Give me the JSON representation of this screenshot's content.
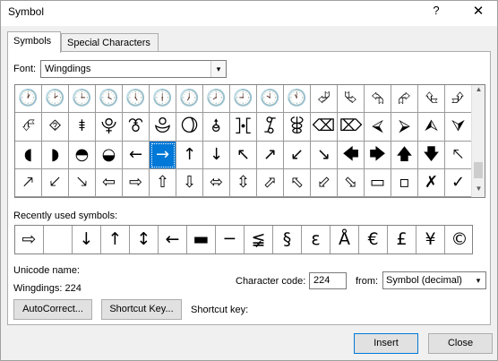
{
  "dialog": {
    "title": "Symbol",
    "help_label": "?",
    "close_glyph": "✕"
  },
  "tabs": [
    {
      "label": "Symbols",
      "active": true
    },
    {
      "label": "Special Characters",
      "active": false
    }
  ],
  "font": {
    "label": "Font:",
    "value": "Wingdings",
    "dropdown_glyph": "▾"
  },
  "symbol_grid": {
    "selected_index": 39,
    "rows": [
      [
        "🕐",
        "🕑",
        "🕒",
        "🕓",
        "🕔",
        "🕕",
        "🕖",
        "🕗",
        "🕘",
        "🕙",
        "🕚",
        "⮰",
        "⮱",
        "⮲",
        "⮳",
        "⮴",
        "⮵"
      ],
      [
        "⮶",
        "⯑",
        "⯒",
        "⯓",
        "⯔",
        "⯕",
        "⯖",
        "⯗",
        "⯘",
        "⯙",
        "⯚",
        "⌫",
        "⌦",
        "⮘",
        "⮚",
        "⮙",
        "⮛"
      ],
      [
        "◖",
        "◗",
        "◓",
        "◒",
        "←",
        "→",
        "↑",
        "↓",
        "↖",
        "↗",
        "↙",
        "↘",
        "🡄",
        "🡆",
        "🡅",
        "🡇",
        "🡔"
      ],
      [
        "🡕",
        "🡗",
        "🡖",
        "⇦",
        "⇨",
        "⇧",
        "⇩",
        "⬄",
        "⇳",
        "⬀",
        "⬁",
        "⬃",
        "⬂",
        "▭",
        "▫",
        "✗",
        "✓"
      ]
    ]
  },
  "scrollbar": {
    "up_glyph": "▲",
    "down_glyph": "▼"
  },
  "recent": {
    "label": "Recently used symbols:",
    "symbols": [
      "⇨",
      "↓",
      " ",
      "↓",
      "↑",
      "↕",
      "←",
      "▬",
      "─",
      "≨",
      "§",
      "ε",
      "Å",
      "€",
      "£",
      "¥",
      "©"
    ]
  },
  "unicode": {
    "name_label": "Unicode name:",
    "name_value": "Wingdings: 224"
  },
  "code": {
    "label": "Character code:",
    "value": "224",
    "from_label": "from:",
    "from_value": "Symbol (decimal)",
    "from_dropdown_glyph": "▾"
  },
  "buttons": {
    "autocorrect": "AutoCorrect...",
    "shortcut_key": "Shortcut Key...",
    "insert": "Insert",
    "close": "Close"
  },
  "shortcut_key_label": "Shortcut key:"
}
